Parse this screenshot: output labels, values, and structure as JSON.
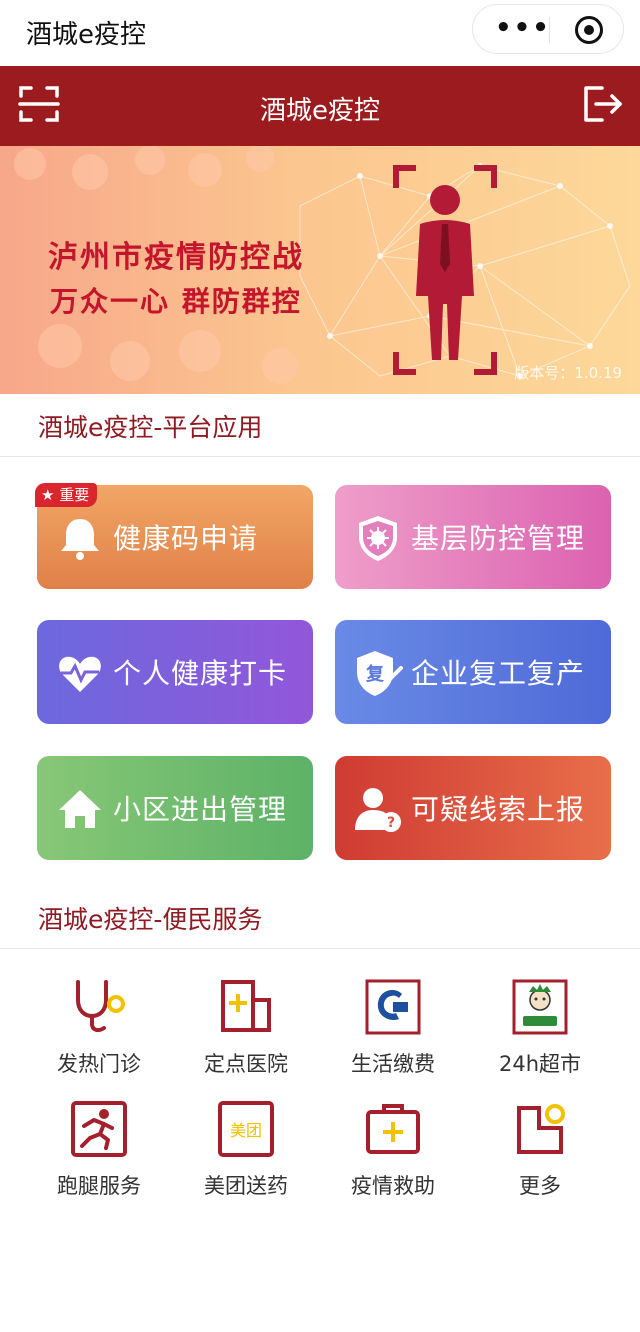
{
  "app": {
    "title": "酒城e疫控"
  },
  "header": {
    "title": "酒城e疫控"
  },
  "banner": {
    "slogan_line1": "泸州市疫情防控战",
    "slogan_line2": "万众一心 群防群控",
    "version": "版本号：1.0.19"
  },
  "apps_section": {
    "title": "酒城e疫控-平台应用",
    "tiles": [
      {
        "label": "健康码申请",
        "icon": "bell-icon",
        "badge": "★ 重要"
      },
      {
        "label": "基层防控管理",
        "icon": "shield-virus-icon"
      },
      {
        "label": "个人健康打卡",
        "icon": "heart-pulse-icon"
      },
      {
        "label": "企业复工复产",
        "icon": "shield-check-icon",
        "icon_text": "复"
      },
      {
        "label": "小区进出管理",
        "icon": "home-icon"
      },
      {
        "label": "可疑线索上报",
        "icon": "user-question-icon"
      }
    ]
  },
  "services_section": {
    "title": "酒城e疫控-便民服务",
    "items": [
      {
        "label": "发热门诊",
        "icon": "stethoscope-icon"
      },
      {
        "label": "定点医院",
        "icon": "hospital-icon"
      },
      {
        "label": "生活缴费",
        "icon": "bank-logo-icon"
      },
      {
        "label": "24h超市",
        "icon": "supermarket-logo-icon"
      },
      {
        "label": "跑腿服务",
        "icon": "runner-icon"
      },
      {
        "label": "美团送药",
        "icon": "meituan-logo-icon",
        "icon_text": "美团"
      },
      {
        "label": "疫情救助",
        "icon": "medical-kit-icon"
      },
      {
        "label": "更多",
        "icon": "more-icon"
      }
    ]
  },
  "colors": {
    "header_red": "#9c1b1f",
    "section_title": "#8f1a22",
    "icon_red": "#a3202c",
    "icon_yellow": "#f2c200"
  }
}
